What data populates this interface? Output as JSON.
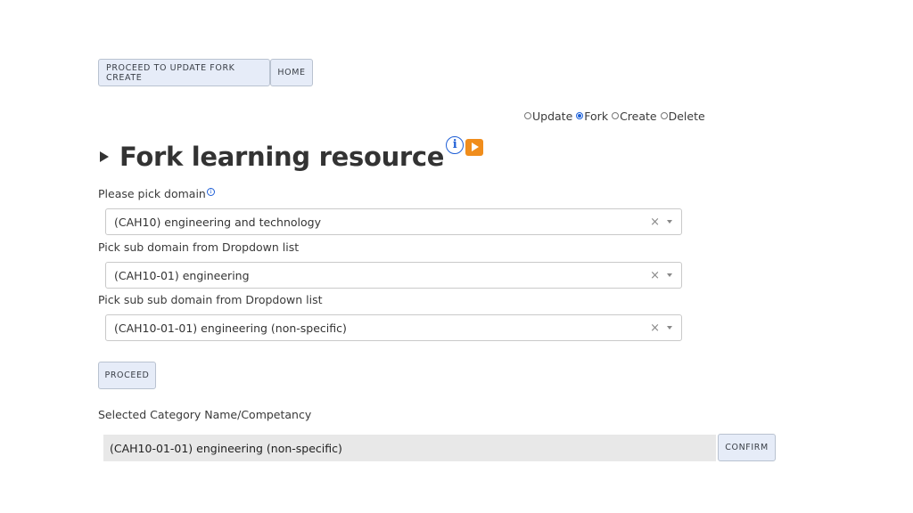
{
  "toolbar": {
    "proceed_update_label": "PROCEED TO UPDATE FORK CREATE",
    "home_label": "HOME"
  },
  "modes": [
    {
      "label": "Update",
      "checked": false
    },
    {
      "label": "Fork",
      "checked": true
    },
    {
      "label": "Create",
      "checked": false
    },
    {
      "label": "Delete",
      "checked": false
    }
  ],
  "heading": {
    "title": "Fork learning resource",
    "info_icon": "i"
  },
  "form": {
    "domain_label": "Please pick domain",
    "domain_info_icon": "i",
    "domain_value": "(CAH10) engineering and technology",
    "subdomain_label": "Pick sub domain from Dropdown list",
    "subdomain_value": "(CAH10-01) engineering",
    "subsubdomain_label": "Pick sub sub domain from Dropdown list",
    "subsubdomain_value": "(CAH10-01-01) engineering (non-specific)",
    "clear_glyph": "×",
    "proceed_label": "PROCEED"
  },
  "selection": {
    "label": "Selected Category Name/Competancy",
    "value": "(CAH10-01-01) engineering (non-specific)",
    "confirm_label": "CONFIRM"
  }
}
